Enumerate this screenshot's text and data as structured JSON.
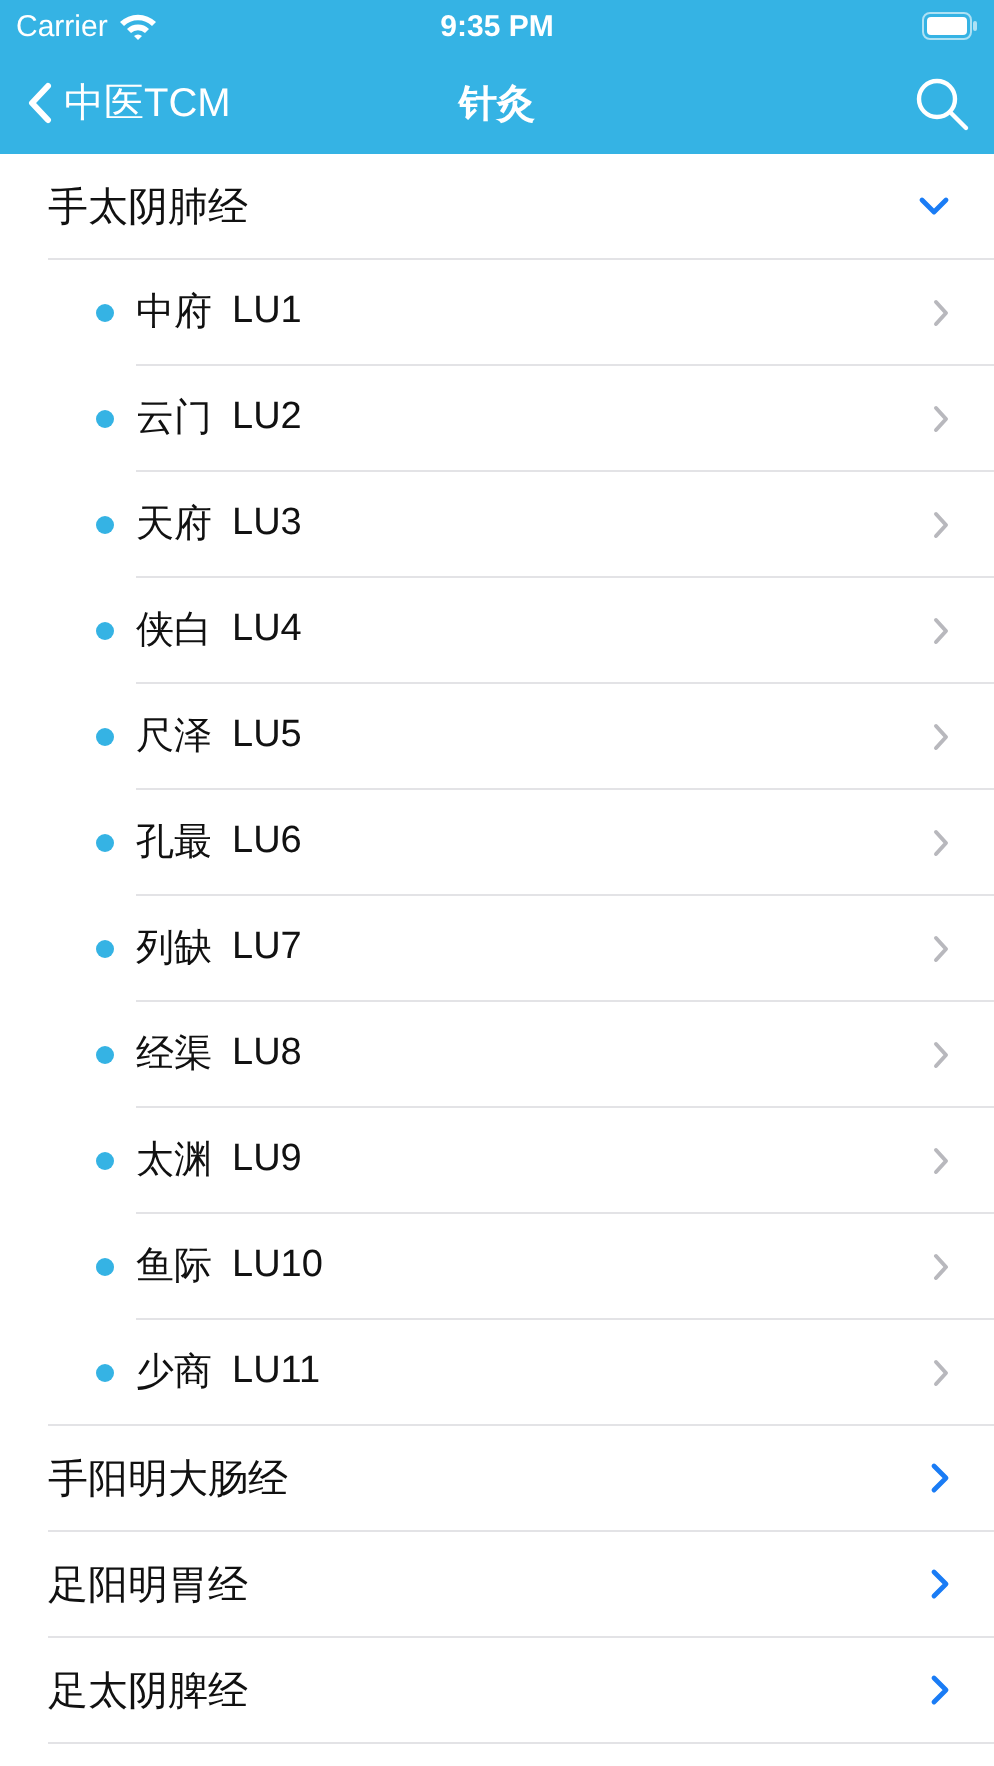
{
  "status_bar": {
    "carrier": "Carrier",
    "time": "9:35 PM"
  },
  "nav": {
    "back": "中医TCM",
    "title": "针灸"
  },
  "meridians": [
    {
      "name": "手太阴肺经",
      "expanded": true,
      "points": [
        {
          "name": "中府",
          "code": "LU1"
        },
        {
          "name": "云门",
          "code": "LU2"
        },
        {
          "name": "天府",
          "code": "LU3"
        },
        {
          "name": "侠白",
          "code": "LU4"
        },
        {
          "name": "尺泽",
          "code": "LU5"
        },
        {
          "name": "孔最",
          "code": "LU6"
        },
        {
          "name": "列缺",
          "code": "LU7"
        },
        {
          "name": "经渠",
          "code": "LU8"
        },
        {
          "name": "太渊",
          "code": "LU9"
        },
        {
          "name": "鱼际",
          "code": "LU10"
        },
        {
          "name": "少商",
          "code": "LU11"
        }
      ]
    },
    {
      "name": "手阳明大肠经",
      "expanded": false
    },
    {
      "name": "足阳明胃经",
      "expanded": false
    },
    {
      "name": "足太阴脾经",
      "expanded": false
    }
  ]
}
